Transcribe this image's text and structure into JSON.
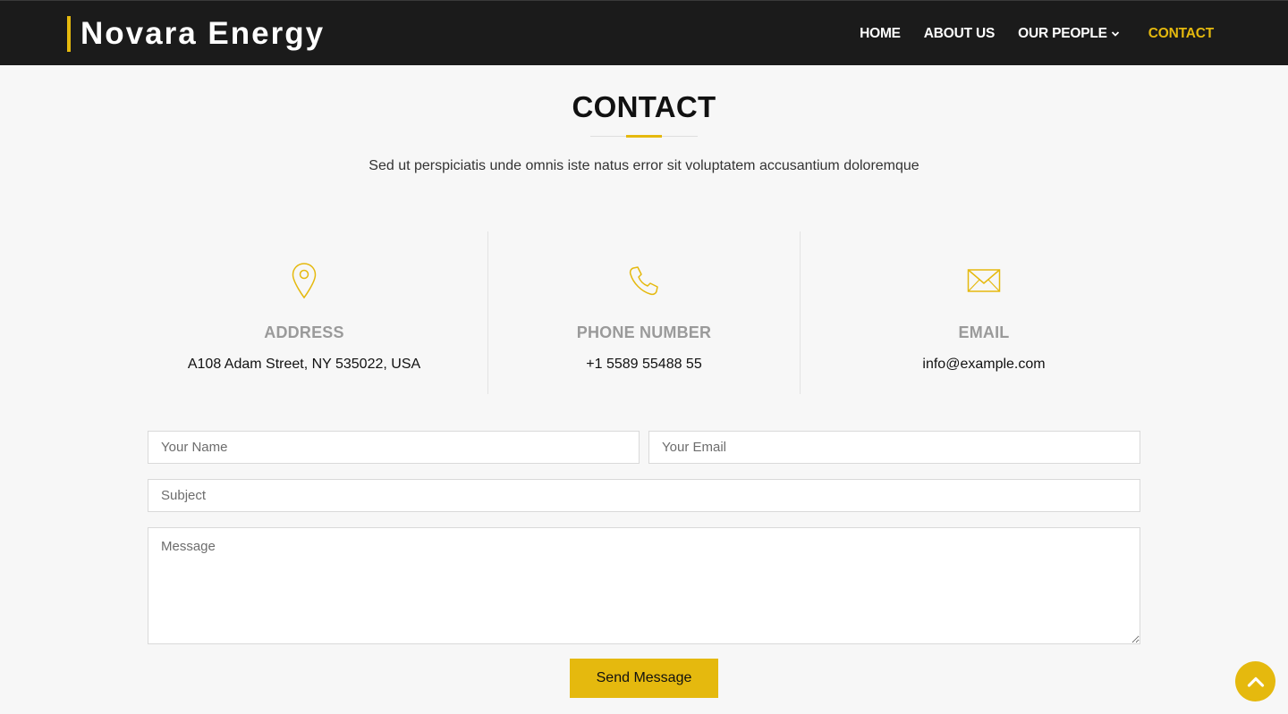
{
  "brand": {
    "name": "Novara Energy",
    "accent": "#e5b90e"
  },
  "nav": {
    "items": [
      {
        "label": "HOME"
      },
      {
        "label": "ABOUT US"
      },
      {
        "label": "OUR PEOPLE",
        "icon": "chevron-down-icon"
      },
      {
        "label": "CONTACT",
        "active": true
      }
    ]
  },
  "section": {
    "title": "CONTACT",
    "subtitle": "Sed ut perspiciatis unde omnis iste natus error sit voluptatem accusantium doloremque"
  },
  "info": [
    {
      "icon": "map-pin-icon",
      "label": "ADDRESS",
      "value": "A108 Adam Street, NY 535022, USA"
    },
    {
      "icon": "phone-icon",
      "label": "PHONE NUMBER",
      "value": "+1 5589 55488 55"
    },
    {
      "icon": "envelope-icon",
      "label": "EMAIL",
      "value": "info@example.com"
    }
  ],
  "form": {
    "name_placeholder": "Your Name",
    "email_placeholder": "Your Email",
    "subject_placeholder": "Subject",
    "message_placeholder": "Message",
    "name_value": "",
    "email_value": "",
    "subject_value": "",
    "message_value": "",
    "submit_label": "Send Message"
  },
  "back_to_top": {
    "icon": "chevron-up-icon"
  }
}
